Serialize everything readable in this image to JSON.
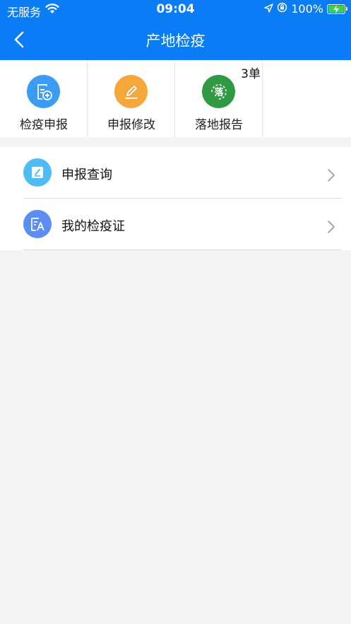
{
  "status_bar": {
    "carrier": "无服务",
    "time": "09:04",
    "battery": "100%"
  },
  "nav": {
    "title": "产地检疫",
    "back_icon": "chevron-left-icon"
  },
  "grid": [
    {
      "label": "检疫申报",
      "icon": "document-add-icon",
      "color": "#3b9cf3"
    },
    {
      "label": "申报修改",
      "icon": "pencil-icon",
      "color": "#f6a73c"
    },
    {
      "label": "落地报告",
      "icon": "landing-icon",
      "color": "#2f9a43",
      "icon_text": "落",
      "badge": "3单"
    }
  ],
  "list": [
    {
      "label": "申报查询",
      "icon": "query-icon",
      "color": "#4fbcf6"
    },
    {
      "label": "我的检疫证",
      "icon": "certificate-icon",
      "color": "#5b8ef2"
    }
  ],
  "colors": {
    "header": "#0a7cf5",
    "background": "#f4f4f4"
  }
}
